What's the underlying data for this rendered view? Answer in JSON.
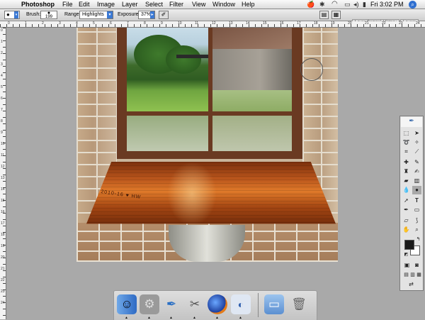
{
  "menubar": {
    "apple_glyph": "",
    "app_name": "Photoshop",
    "menus": [
      "File",
      "Edit",
      "Image",
      "Layer",
      "Select",
      "Filter",
      "View",
      "Window",
      "Help"
    ],
    "clock": "Fri 3:02 PM",
    "status_icons": [
      "app-menu-icon",
      "bluetooth-icon",
      "wifi-icon",
      "display-icon",
      "volume-icon",
      "battery-icon",
      "spotlight-icon"
    ]
  },
  "options_bar": {
    "brush_label": "Brush:",
    "brush_size": "199",
    "range_label": "Range:",
    "range_value": "Highlights",
    "exposure_label": "Exposure:",
    "exposure_value": "37%",
    "palette_tabs": [
      "Layer Comps",
      "History",
      "Layers"
    ]
  },
  "ruler_labels": {
    "horizontal": [
      "0",
      "1",
      "2",
      "3",
      "4",
      "5",
      "6",
      "7",
      "8",
      "9",
      "10",
      "11",
      "12",
      "13",
      "14",
      "15",
      "16",
      "17",
      "18",
      "19",
      "20",
      "21",
      "22",
      "23",
      "24"
    ],
    "vertical": [
      "0",
      "1",
      "2",
      "3",
      "4",
      "5",
      "6",
      "7",
      "8",
      "9",
      "10",
      "11",
      "12",
      "13",
      "14",
      "15",
      "16",
      "17",
      "18",
      "19",
      "20",
      "21",
      "22",
      "23",
      "24",
      "25",
      "26"
    ]
  },
  "canvas": {
    "carving_text": "2010-16 ♥ HW"
  },
  "tools": [
    "marquee-tool",
    "move-tool",
    "lasso-tool",
    "magic-wand-tool",
    "crop-tool",
    "slice-tool",
    "healing-brush-tool",
    "brush-tool",
    "clone-stamp-tool",
    "history-brush-tool",
    "eraser-tool",
    "gradient-tool",
    "blur-tool",
    "burn-tool",
    "path-selection-tool",
    "type-tool",
    "pen-tool",
    "shape-tool",
    "notes-tool",
    "eyedropper-tool",
    "hand-tool",
    "zoom-tool"
  ],
  "colors": {
    "foreground": "#1a1a1a",
    "background": "#ffffff",
    "accent": "#3b79d4"
  },
  "dock": [
    "finder-icon",
    "system-prefs-icon",
    "feather-icon",
    "scissors-icon",
    "firefox-icon",
    "preview-icon",
    "folder-icon",
    "trash-icon"
  ]
}
